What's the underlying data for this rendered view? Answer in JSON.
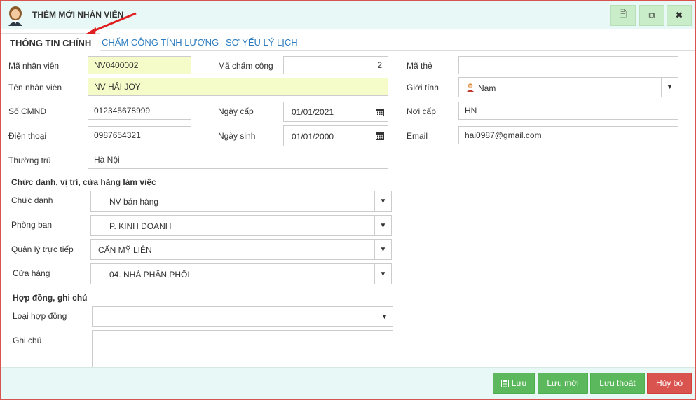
{
  "window": {
    "title": "THÊM MỚI NHÂN VIÊN",
    "toolbar_icons": [
      "document-icon",
      "copy-icon",
      "close-icon"
    ],
    "toolbar_glyphs": [
      "🗎",
      "⧉",
      "✖"
    ]
  },
  "tabs": [
    {
      "label": "THÔNG TIN CHÍNH",
      "active": true
    },
    {
      "label": "CHẤM CÔNG TÍNH LƯƠNG",
      "active": false
    },
    {
      "label": "SƠ YẾU LÝ LỊCH",
      "active": false
    }
  ],
  "form": {
    "ma_nhan_vien": {
      "label": "Mã nhân viên",
      "value": "NV0400002"
    },
    "ma_cham_cong": {
      "label": "Mã chấm công",
      "value": "2"
    },
    "ma_the": {
      "label": "Mã thẻ",
      "value": ""
    },
    "ten_nhan_vien": {
      "label": "Tên nhân viên",
      "value": "NV HẢI JOY"
    },
    "gioi_tinh": {
      "label": "Giới tính",
      "value": "Nam"
    },
    "so_cmnd": {
      "label": "Số CMND",
      "value": "012345678999"
    },
    "ngay_cap": {
      "label": "Ngày cấp",
      "value": "01/01/2021"
    },
    "noi_cap": {
      "label": "Nơi cấp",
      "value": "HN"
    },
    "dien_thoai": {
      "label": "Điện thoại",
      "value": "0987654321"
    },
    "ngay_sinh": {
      "label": "Ngày sinh",
      "value": "01/01/2000"
    },
    "email": {
      "label": "Email",
      "value": "hai0987@gmail.com"
    },
    "thuong_tru": {
      "label": "Thường trú",
      "value": "Hà Nội"
    }
  },
  "section_position": {
    "heading": "Chức danh, vị trí, cửa hàng làm việc",
    "chuc_danh": {
      "label": "Chức danh",
      "value": "NV bán hàng"
    },
    "phong_ban": {
      "label": "Phòng ban",
      "value": "P. KINH DOANH"
    },
    "quan_ly": {
      "label": "Quản lý trực tiếp",
      "value": "CẤN MỸ LIÊN"
    },
    "cua_hang": {
      "label": "Cửa hàng",
      "value": "04. NHÀ PHÂN PHỐI"
    }
  },
  "section_contract": {
    "heading": "Hợp đồng, ghi chú",
    "loai_hop_dong": {
      "label": "Loại hợp đồng",
      "value": ""
    },
    "ghi_chu": {
      "label": "Ghi chú",
      "value": ""
    }
  },
  "footer": {
    "save": "Lưu",
    "save_new": "Lưu mới",
    "save_exit": "Lưu thoát",
    "cancel": "Hủy bỏ"
  },
  "colors": {
    "accent_blue": "#2a7bbf",
    "header_bg": "#e8f8f6",
    "button_green": "#5cb85c",
    "button_red": "#d9534f",
    "highlight_yellow": "#f5fbc9",
    "annotation_arrow": "#e02020"
  }
}
